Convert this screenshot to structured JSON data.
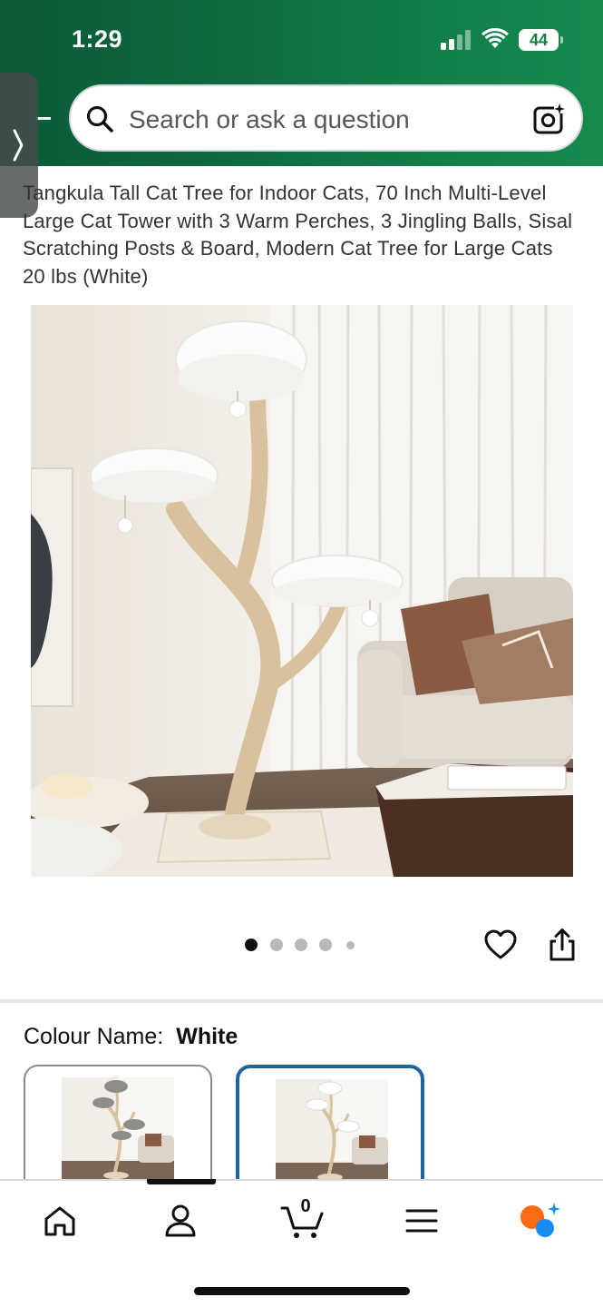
{
  "status_bar": {
    "time": "1:29",
    "battery": "44"
  },
  "search": {
    "placeholder": "Search or ask a question"
  },
  "product": {
    "title": "Tangkula Tall Cat Tree for Indoor Cats, 70 Inch Multi-Level Large Cat Tower with 3 Warm Perches, 3 Jingling Balls, Sisal Scratching Posts & Board, Modern Cat Tree for Large Cats 20 lbs (White)",
    "image_count": 5,
    "active_image": 1
  },
  "variation": {
    "label": "Colour Name:",
    "value": "White",
    "swatches": [
      {
        "name": "Grey",
        "selected": false
      },
      {
        "name": "White",
        "selected": true
      }
    ]
  },
  "bottom_nav": {
    "items": [
      "home-icon",
      "account-icon",
      "cart-icon",
      "menu-icon",
      "rufus-icon"
    ],
    "cart_count": "0"
  },
  "colors": {
    "header_start": "#0b5a36",
    "header_end": "#158a4f",
    "selected_border": "#2162a1",
    "rufus_orange": "#ff6a13",
    "rufus_blue": "#1a8bf0"
  }
}
